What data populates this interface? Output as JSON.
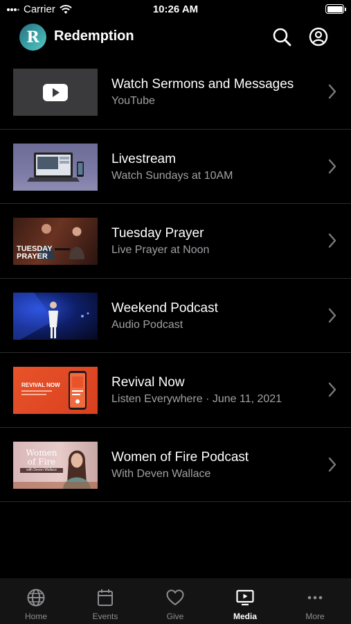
{
  "status": {
    "carrier": "Carrier",
    "time": "10:26 AM"
  },
  "header": {
    "title": "Redemption",
    "logo_letter": "R"
  },
  "items": [
    {
      "title": "Watch Sermons and Messages",
      "subtitle": "YouTube",
      "thumb": "youtube-thumbnail"
    },
    {
      "title": "Livestream",
      "subtitle": "Watch Sundays at 10AM",
      "thumb": "livestream-thumbnail"
    },
    {
      "title": "Tuesday Prayer",
      "subtitle": "Live Prayer at Noon",
      "thumb": "tuesday-prayer-thumbnail",
      "thumb_text": "TUESDAY PRAYER"
    },
    {
      "title": "Weekend Podcast",
      "subtitle": "Audio Podcast",
      "thumb": "weekend-podcast-thumbnail"
    },
    {
      "title": "Revival Now",
      "subtitle": "Listen Everywhere · June 11, 2021",
      "thumb": "revival-now-thumbnail",
      "thumb_text": "REVIVAL NOW"
    },
    {
      "title": "Women of Fire Podcast",
      "subtitle": "With Deven Wallace",
      "thumb": "women-of-fire-thumbnail",
      "thumb_text_1": "Women",
      "thumb_text_2": "of Fire",
      "thumb_text_3": "with Deven Wallace"
    }
  ],
  "tabs": [
    {
      "label": "Home",
      "icon": "globe-icon",
      "active": false
    },
    {
      "label": "Events",
      "icon": "calendar-icon",
      "active": false
    },
    {
      "label": "Give",
      "icon": "heart-icon",
      "active": false
    },
    {
      "label": "Media",
      "icon": "play-screen-icon",
      "active": true
    },
    {
      "label": "More",
      "icon": "more-icon",
      "active": false
    }
  ],
  "colors": {
    "background": "#000000",
    "secondary_text": "#a1a1a6",
    "separator": "#2c2c2e",
    "tab_bar": "#141414",
    "revival_orange": "#e8532a",
    "logo_teal": "#3aa3a8"
  }
}
